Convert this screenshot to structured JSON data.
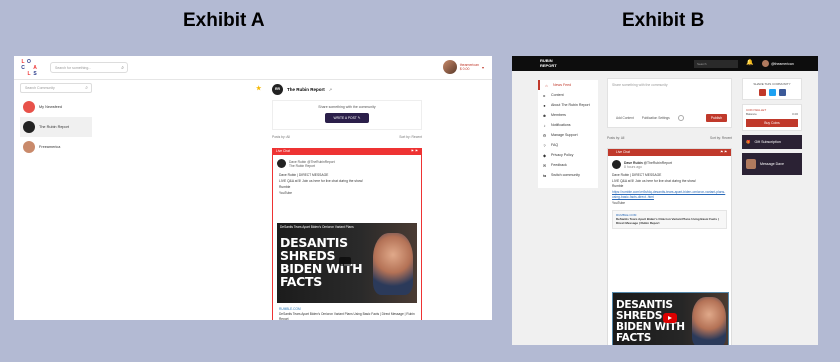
{
  "titles": {
    "a": "Exhibit A",
    "b": "Exhibit B"
  },
  "exhibit_a": {
    "logo_letters": [
      "L",
      "O",
      "",
      "C",
      "",
      "A",
      "",
      "L",
      "S"
    ],
    "search_placeholder": "Search for something...",
    "user_name": "theamerican",
    "user_sub": "$ 0.00",
    "left_search_placeholder": "Search Community",
    "communities": [
      "My Newsfeed",
      "The Rubin Report",
      "Freeamerica"
    ],
    "community_title": "The Rubin Report",
    "community_logo": "RR",
    "share_prompt": "Share something with the community",
    "write_post": "WRITE A POST",
    "posts_by_label": "Posts by: All",
    "sort_label": "Sort by: Recent",
    "post_bar": "Live Chat",
    "post_author": "Dave Rubin",
    "post_handle": "@TheRubinReport",
    "post_community": "The Rubin Report",
    "post_lines": [
      "Dave Rubin | DIRECT MESSAGE",
      "LIVE Q&A at 5! Join us here for live chat during the show!",
      "Rumble",
      "YouTube"
    ],
    "thumb_caption": "DeSantis Tears Apart Biden's Omicron Variant Plans",
    "thumb_big": [
      "DESANTIS",
      "SHREDS",
      "BIDEN WITH",
      "FACTS"
    ],
    "link_source": "RUMBLE.COM",
    "link_title": "DeSantis Tears Apart Biden's Omicron Variant Plans Using Basic Facts | Direct Message | Rubin Report"
  },
  "exhibit_b": {
    "logo": [
      "RUBIN",
      "REPORT"
    ],
    "search_placeholder": "Search",
    "user_name": "@theamerican",
    "nav": [
      "News Feed",
      "Content",
      "About The Rubin Report",
      "Members",
      "Notifications",
      "Manage Support",
      "FAQ",
      "Privacy Policy",
      "Feedback",
      "Switch community"
    ],
    "compose_placeholder": "Share something with the community",
    "compose_options": [
      "Add Content",
      "Publication Settings"
    ],
    "publish": "Publish",
    "posts_by_label": "Posts by: All",
    "sort_label": "Sort by: Recent",
    "post_bar": "Live Chat",
    "post_author": "Dave Rubin",
    "post_handle": "@TheRubinReport",
    "post_time": "8 hours ago",
    "post_lines": [
      "Dave Rubin | DIRECT MESSAGE",
      "LIVE Q&A at 5! Join us here for live chat during the show!",
      "Rumble"
    ],
    "post_link": "https://rumble.com/vn9ufdq-desantis-tears-apart-biden-omicron-variant-plans-using-basic-facts-direct..html",
    "post_youtube": "YouTube",
    "card_source": "RUMBLE.COM",
    "card_title": "DeSantis Tears Apart Biden's Omicron Variant Plans Using Basic Facts | Direct Message | Rubin Report",
    "thumb_big": [
      "DESANTIS",
      "SHREDS",
      "BIDEN WITH",
      "FACTS"
    ],
    "share_label": "SHARE THIS COMMUNITY",
    "coins_label": "COIN WALLET",
    "balance_label": "Balance",
    "balance_value": "0.00",
    "buy_coins": "Buy Coins",
    "gift_sub": "Gift Subscription",
    "message_dave": "Message Dave"
  }
}
